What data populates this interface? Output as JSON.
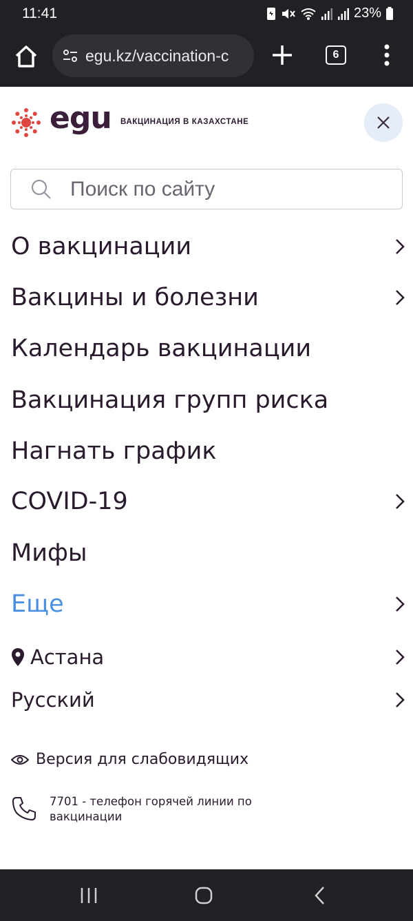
{
  "status_bar": {
    "time": "11:41",
    "battery": "23%"
  },
  "browser": {
    "url": "egu.kz/vaccination-c",
    "tab_count": "6"
  },
  "site": {
    "logo_text": "egu",
    "tagline": "ВАКЦИНАЦИЯ В КАЗАХСТАНЕ",
    "brand_color": "#e0463f",
    "accent_color": "#4a90e2"
  },
  "search": {
    "placeholder": "Поиск по сайту"
  },
  "menu": {
    "items": [
      {
        "label": "О вакцинации",
        "has_chevron": true
      },
      {
        "label": "Вакцины и болезни",
        "has_chevron": true
      },
      {
        "label": "Календарь вакцинации",
        "has_chevron": false
      },
      {
        "label": "Вакцинация групп риска",
        "has_chevron": false
      },
      {
        "label": "Нагнать график",
        "has_chevron": false
      },
      {
        "label": "COVID-19",
        "has_chevron": true
      },
      {
        "label": "Мифы",
        "has_chevron": false
      },
      {
        "label": "Еще",
        "has_chevron": true,
        "accent": true
      }
    ],
    "city": "Астана",
    "language": "Русский"
  },
  "utility": {
    "low_vision": "Версия для слабовидящих",
    "hotline": "7701 - телефон горячей линии по вакцинации"
  }
}
